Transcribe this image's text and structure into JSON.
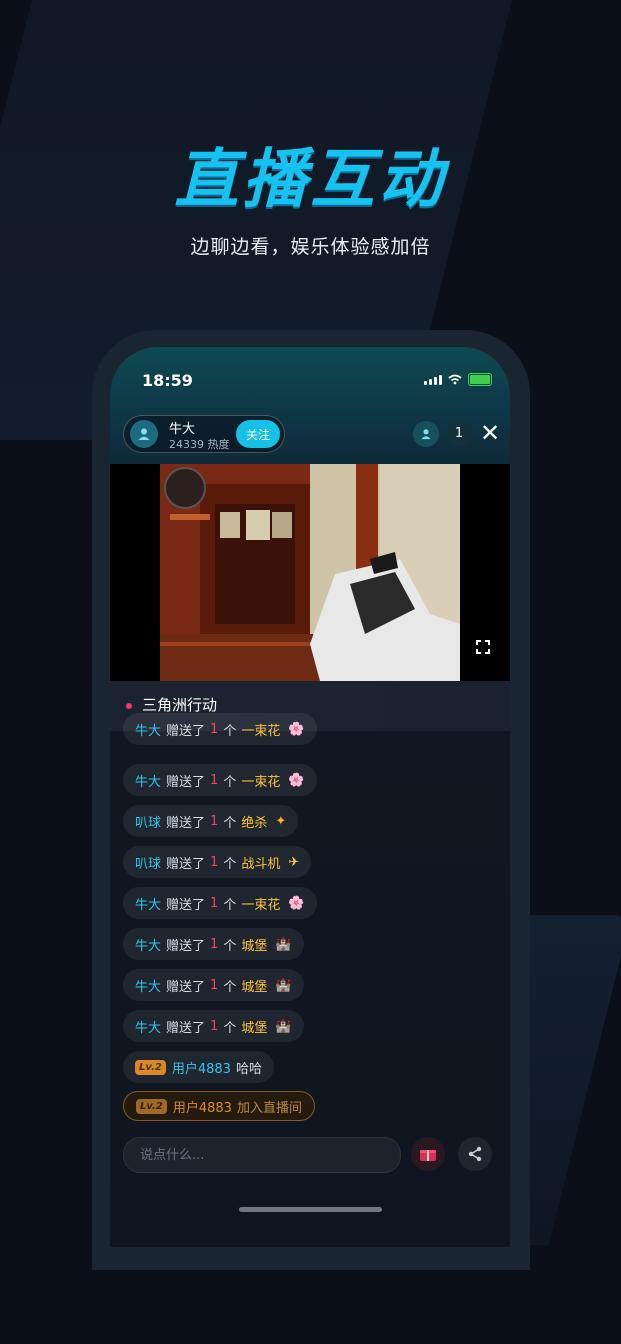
{
  "promo": {
    "headline": "直播互动",
    "subline": "边聊边看，娱乐体验感加倍"
  },
  "status_bar": {
    "time": "18:59"
  },
  "host": {
    "name": "牛大",
    "heat": "24339 热度",
    "follow_label": "关注"
  },
  "viewers": {
    "count": "1"
  },
  "close": {
    "label": "✕"
  },
  "channel": {
    "name": "三角洲行动",
    "live_dot_color": "#ff2f6b"
  },
  "chat": {
    "messages": [
      {
        "user": "牛大",
        "action": "赠送了",
        "count": "1",
        "unit": "个",
        "gift": "一束花",
        "icon": "🌸"
      },
      {
        "user": "牛大",
        "action": "赠送了",
        "count": "1",
        "unit": "个",
        "gift": "一束花",
        "icon": "🌸"
      },
      {
        "user": "叭球",
        "action": "赠送了",
        "count": "1",
        "unit": "个",
        "gift": "绝杀",
        "icon": "✦"
      },
      {
        "user": "叭球",
        "action": "赠送了",
        "count": "1",
        "unit": "个",
        "gift": "战斗机",
        "icon": "✈"
      },
      {
        "user": "牛大",
        "action": "赠送了",
        "count": "1",
        "unit": "个",
        "gift": "一束花",
        "icon": "🌸"
      },
      {
        "user": "牛大",
        "action": "赠送了",
        "count": "1",
        "unit": "个",
        "gift": "城堡",
        "icon": "🏰"
      },
      {
        "user": "牛大",
        "action": "赠送了",
        "count": "1",
        "unit": "个",
        "gift": "城堡",
        "icon": "🏰"
      },
      {
        "user": "牛大",
        "action": "赠送了",
        "count": "1",
        "unit": "个",
        "gift": "城堡",
        "icon": "🏰"
      }
    ],
    "text_message": {
      "level": "Lv.2",
      "user": "用户4883",
      "text": "哈哈"
    },
    "join_message": {
      "level": "Lv.2",
      "user": "用户4883",
      "text": "加入直播间"
    }
  },
  "input": {
    "placeholder": "说点什么..."
  },
  "colors": {
    "accent": "#13c2e6",
    "gift_text": "#ffc433",
    "count": "#ff3d5e",
    "username": "#31c6ea"
  }
}
